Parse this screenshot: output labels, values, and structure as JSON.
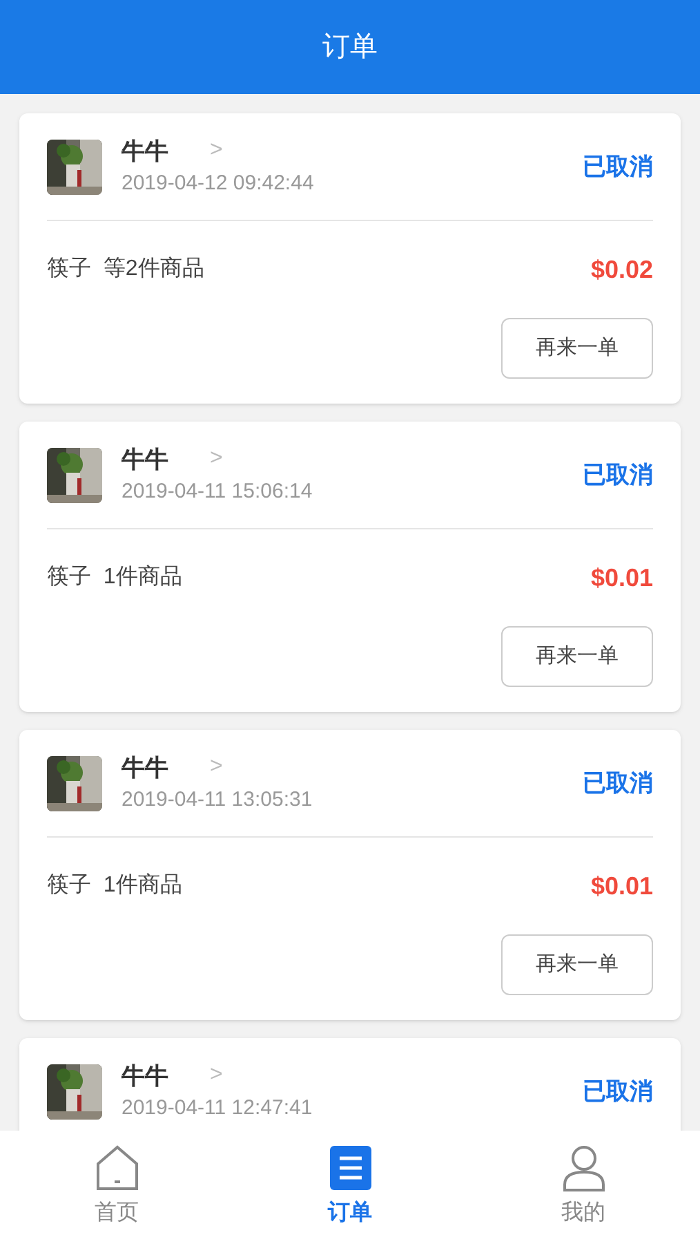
{
  "header": {
    "title": "订单"
  },
  "orders": [
    {
      "shop": "牛牛",
      "chevron": ">",
      "time": "2019-04-12 09:42:44",
      "status": "已取消",
      "items": "筷子  等2件商品",
      "price": "$0.02",
      "action": "再来一单"
    },
    {
      "shop": "牛牛",
      "chevron": ">",
      "time": "2019-04-11 15:06:14",
      "status": "已取消",
      "items": "筷子  1件商品",
      "price": "$0.01",
      "action": "再来一单"
    },
    {
      "shop": "牛牛",
      "chevron": ">",
      "time": "2019-04-11 13:05:31",
      "status": "已取消",
      "items": "筷子  1件商品",
      "price": "$0.01",
      "action": "再来一单"
    },
    {
      "shop": "牛牛",
      "chevron": ">",
      "time": "2019-04-11 12:47:41",
      "status": "已取消"
    }
  ],
  "tabs": [
    {
      "kind": "home",
      "label": "首页",
      "selected": false
    },
    {
      "kind": "orders",
      "label": "订单",
      "selected": true
    },
    {
      "kind": "profile",
      "label": "我的",
      "selected": false
    }
  ]
}
